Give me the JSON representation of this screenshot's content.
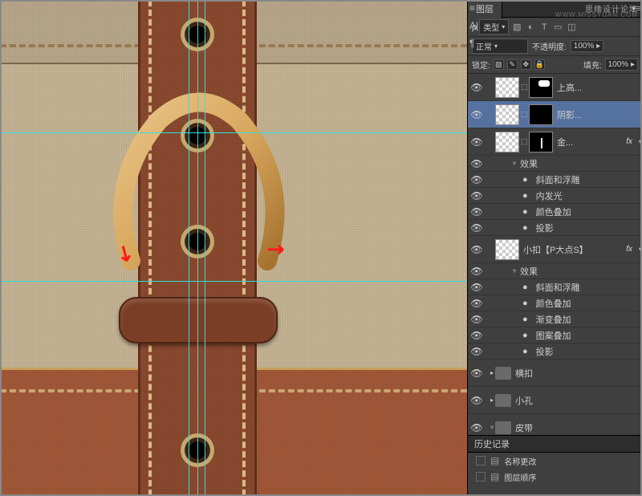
{
  "watermark": {
    "line1": "思缘设计论坛",
    "line2": "WWW.MISSYUAN.COM"
  },
  "panel": {
    "tab": "图层",
    "filter_label": "类型",
    "blend_mode": "正常",
    "opacity_label": "不透明度:",
    "opacity_value": "100%",
    "lock_label": "锁定:",
    "fill_label": "填充:",
    "fill_value": "100%"
  },
  "layers": [
    {
      "name": "上高...",
      "mask": "white-rect"
    },
    {
      "name": "阴影...",
      "mask": "plain",
      "selected": true
    },
    {
      "name": "金...",
      "mask": "dot",
      "fx": true
    },
    {
      "name": "效果",
      "sub": true,
      "expand": true,
      "indent": 3
    },
    {
      "name": "斜面和浮雕",
      "sub": true,
      "bullet": true,
      "indent": 4
    },
    {
      "name": "内发光",
      "sub": true,
      "bullet": true,
      "indent": 4
    },
    {
      "name": "颜色叠加",
      "sub": true,
      "bullet": true,
      "indent": 4
    },
    {
      "name": "投影",
      "sub": true,
      "bullet": true,
      "indent": 4
    },
    {
      "name": "小扣【P大点S】",
      "nomask": true,
      "fx": true
    },
    {
      "name": "效果",
      "sub": true,
      "expand": true,
      "indent": 3
    },
    {
      "name": "斜面和浮雕",
      "sub": true,
      "bullet": true,
      "indent": 4
    },
    {
      "name": "颜色叠加",
      "sub": true,
      "bullet": true,
      "indent": 4
    },
    {
      "name": "渐变叠加",
      "sub": true,
      "bullet": true,
      "indent": 4
    },
    {
      "name": "图案叠加",
      "sub": true,
      "bullet": true,
      "indent": 4
    },
    {
      "name": "投影",
      "sub": true,
      "bullet": true,
      "indent": 4
    },
    {
      "name": "横扣",
      "folder": true
    },
    {
      "name": "小孔",
      "folder": true
    },
    {
      "name": "皮带",
      "folder": true,
      "open": true
    }
  ],
  "history": {
    "title": "历史记录",
    "items": [
      "名称更改",
      "图层顺序"
    ]
  }
}
